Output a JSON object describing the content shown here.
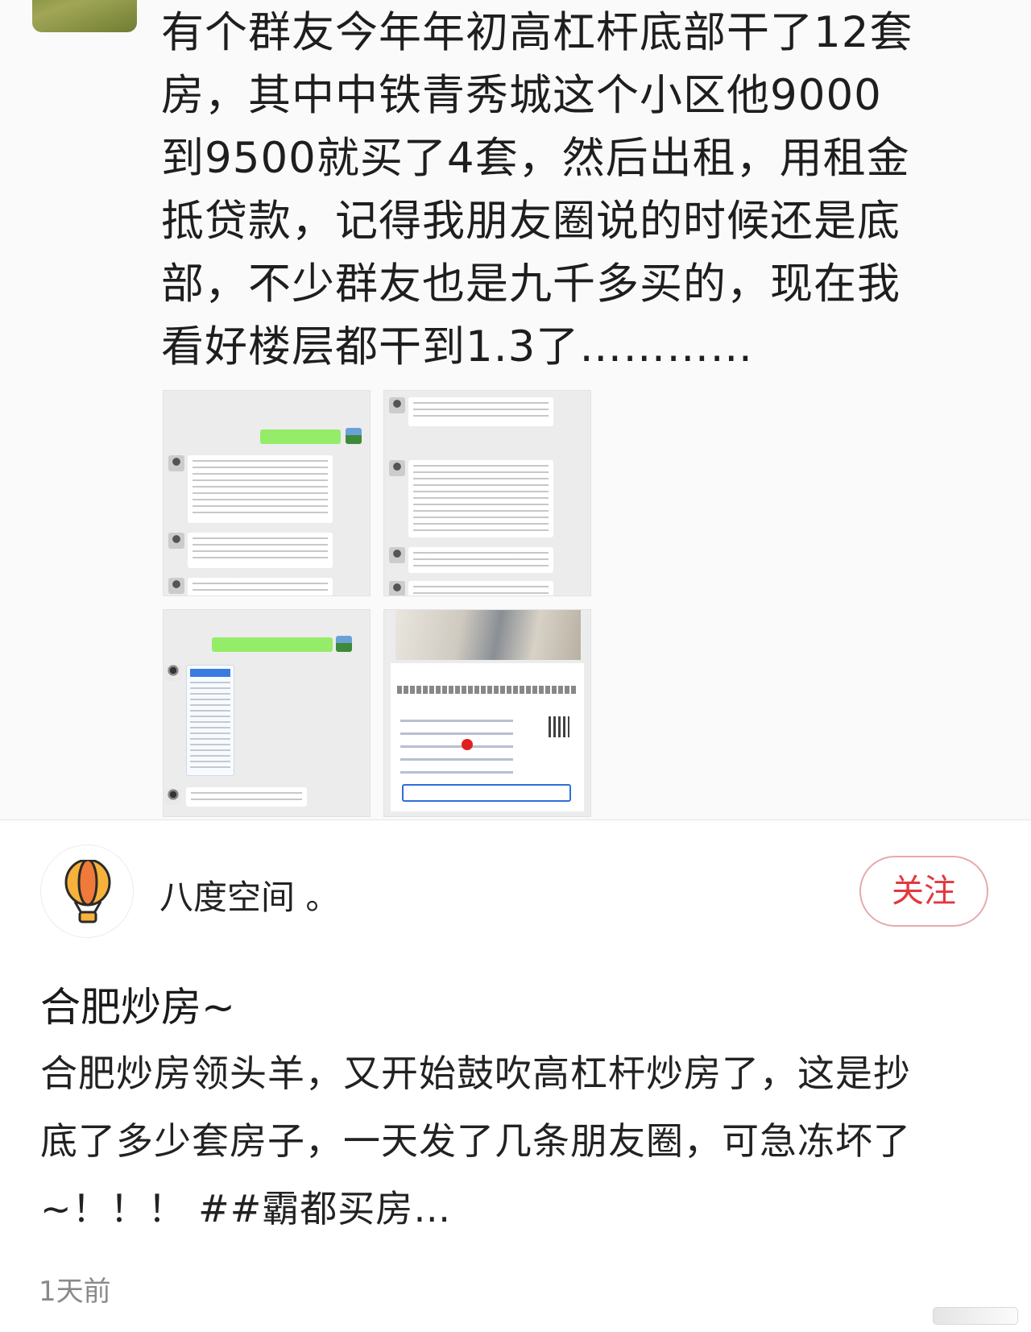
{
  "quoted_post": {
    "lines": [
      "有个群友今年年初高杠杆底部干了12套",
      "房，其中中铁青秀城这个小区他9000",
      "到9500就买了4套，然后出租，用租金",
      "抵贷款，记得我朋友圈说的时候还是底",
      "部，不少群友也是九千多买的，现在我",
      "看好楼层都干到1.3了…………"
    ],
    "images": [
      "chat-screenshot-1",
      "chat-screenshot-2",
      "chat-screenshot-3",
      "listing-screenshot"
    ]
  },
  "profile": {
    "name": "八度空间 。",
    "avatar_icon": "hot-air-balloon-icon",
    "follow_label": "关注"
  },
  "post": {
    "title": "合肥炒房~",
    "body_lines": [
      "合肥炒房领头羊，又开始鼓吹高杠杆炒房了，这是抄",
      "底了多少套房子，一天发了几条朋友圈，可急冻坏了",
      "~！！！ ##霸都买房…"
    ],
    "time": "1天前"
  },
  "colors": {
    "follow_text": "#e3383e",
    "follow_border": "#e8a9ab",
    "chat_green": "#95ec69"
  }
}
